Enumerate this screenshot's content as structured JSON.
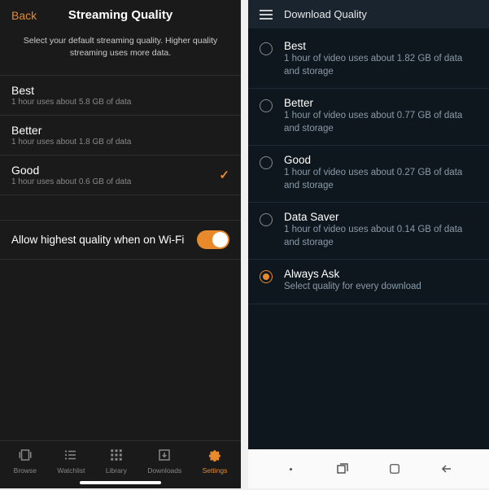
{
  "left": {
    "back": "Back",
    "title": "Streaming Quality",
    "subtitle": "Select your default streaming quality. Higher quality streaming uses more data.",
    "options": [
      {
        "title": "Best",
        "desc": "1 hour uses about 5.8 GB of data"
      },
      {
        "title": "Better",
        "desc": "1 hour uses about 1.8 GB of data"
      },
      {
        "title": "Good",
        "desc": "1 hour uses about 0.6 GB of data"
      }
    ],
    "toggle_label": "Allow highest quality when on Wi-Fi",
    "tabs": {
      "browse": "Browse",
      "watchlist": "Watchlist",
      "library": "Library",
      "downloads": "Downloads",
      "settings": "Settings"
    }
  },
  "right": {
    "title": "Download Quality",
    "options": [
      {
        "title": "Best",
        "desc": "1 hour of video uses about 1.82 GB of data and storage"
      },
      {
        "title": "Better",
        "desc": "1 hour of video uses about 0.77 GB of data and storage"
      },
      {
        "title": "Good",
        "desc": "1 hour of video uses about 0.27 GB of data and storage"
      },
      {
        "title": "Data Saver",
        "desc": "1 hour of video uses about 0.14 GB of data and storage"
      },
      {
        "title": "Always Ask",
        "desc": "Select quality for every download"
      }
    ]
  }
}
